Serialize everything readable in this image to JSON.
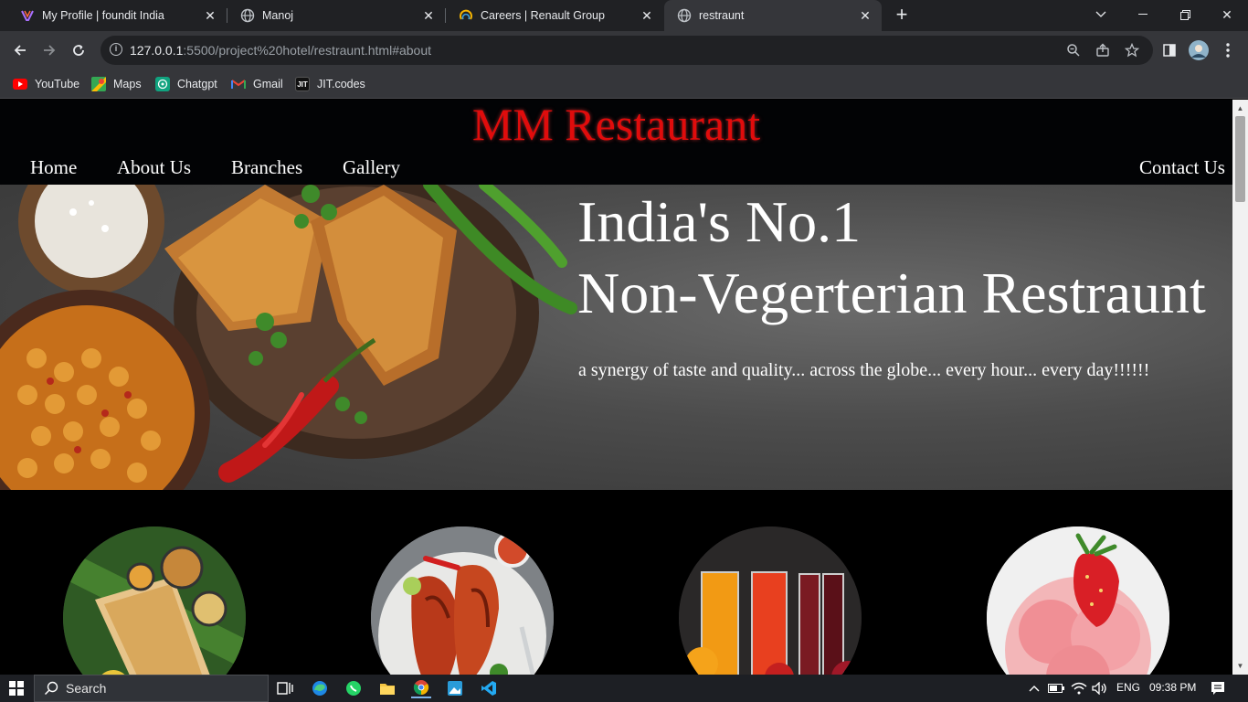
{
  "browser": {
    "tabs": [
      {
        "title": "My Profile | foundit India",
        "icon": "foundit-icon",
        "active": false
      },
      {
        "title": "Manoj",
        "icon": "globe-icon",
        "active": false
      },
      {
        "title": "Careers | Renault Group",
        "icon": "renault-icon",
        "active": false
      },
      {
        "title": "restraunt",
        "icon": "globe-icon",
        "active": true
      }
    ],
    "url_host": "127.0.0.1",
    "url_rest": ":5500/project%20hotel/restraunt.html#about",
    "bookmarks": [
      {
        "label": "YouTube",
        "icon": "youtube-icon",
        "color": "#ff0000"
      },
      {
        "label": "Maps",
        "icon": "maps-icon",
        "color": "#34a853"
      },
      {
        "label": "Chatgpt",
        "icon": "chatgpt-icon",
        "color": "#10a37f"
      },
      {
        "label": "Gmail",
        "icon": "gmail-icon",
        "color": "#ea4335"
      },
      {
        "label": "JIT.codes",
        "icon": "jit-icon",
        "color": "#111111",
        "glyph": "JIT"
      }
    ]
  },
  "site": {
    "brand": "MM Restaurant",
    "brand_color": "#e00c0c",
    "nav": {
      "home": "Home",
      "about": "About Us",
      "branches": "Branches",
      "gallery": "Gallery",
      "contact": "Contact Us"
    },
    "hero": {
      "line1": "India's No.1",
      "line2": "Non-Vegerterian Restraunt",
      "tagline": "a synergy of taste and quality... across the globe... every hour... every day!!!!!!"
    },
    "dishes": [
      "dosa-image",
      "tandoori-chicken-image",
      "juices-image",
      "strawberry-icecream-image"
    ]
  },
  "taskbar": {
    "search_placeholder": "Search",
    "language": "ENG",
    "time": "09:38 PM"
  }
}
